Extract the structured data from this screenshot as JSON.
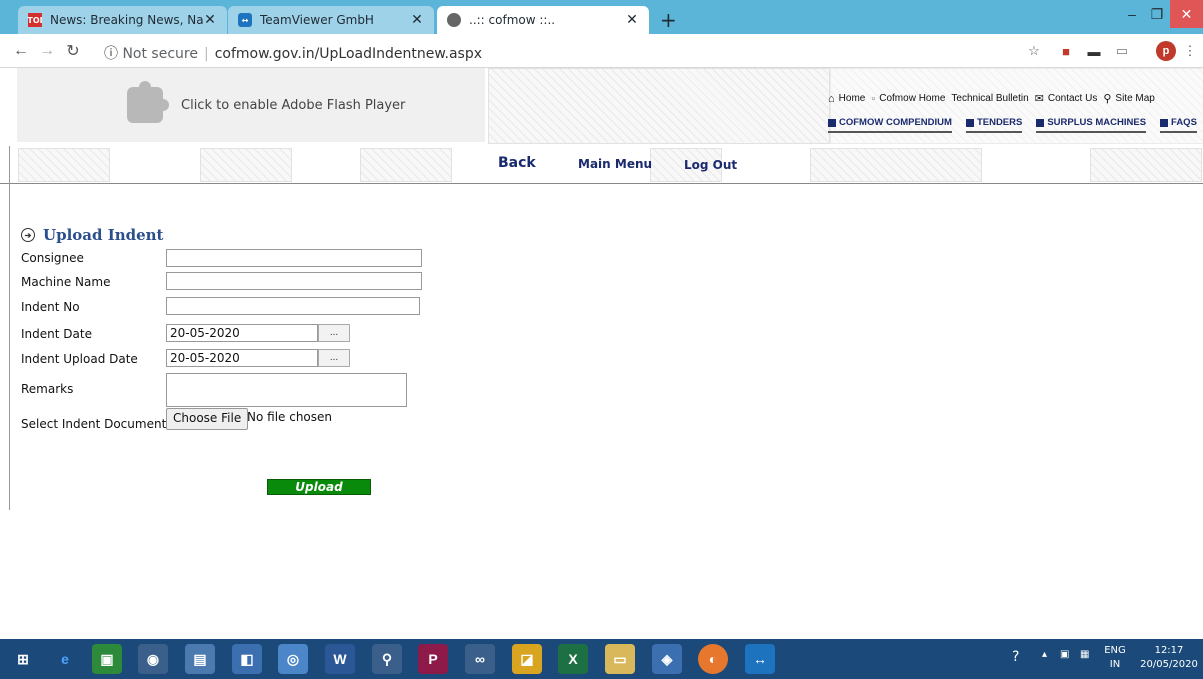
{
  "browser": {
    "tabs": [
      {
        "title": "News: Breaking News, National n",
        "favicon": "TOI",
        "active": false
      },
      {
        "title": "TeamViewer GmbH",
        "favicon": "teamviewer-icon",
        "active": false
      },
      {
        "title": "..:: cofmow ::..",
        "favicon": "globe-icon",
        "active": true
      }
    ],
    "new_tab_label": "+",
    "address": {
      "security": "Not secure",
      "url": "cofmow.gov.in/UpLoadIndentnew.aspx"
    },
    "profile_initial": "p"
  },
  "page": {
    "flash_prompt": "Click to enable Adobe Flash Player",
    "top_links": [
      "Home",
      "Cofmow Home",
      "Technical Bulletin",
      "Contact Us",
      "Site Map"
    ],
    "sub_links": [
      "COFMOW COMPENDIUM",
      "TENDERS",
      "SURPLUS MACHINES",
      "FAQS"
    ],
    "nav": {
      "back": "Back",
      "main_menu": "Main Menu",
      "logout": "Log Out"
    }
  },
  "form": {
    "title": "Upload Indent",
    "fields": {
      "consignee": {
        "label": "Consignee",
        "value": ""
      },
      "machine_name": {
        "label": "Machine Name",
        "value": ""
      },
      "indent_no": {
        "label": "Indent No",
        "value": ""
      },
      "indent_date": {
        "label": "Indent Date",
        "value": "20-05-2020"
      },
      "indent_upload_date": {
        "label": "Indent Upload Date",
        "value": "20-05-2020"
      },
      "remarks": {
        "label": "Remarks",
        "value": ""
      },
      "document": {
        "label": "Select Indent Document"
      }
    },
    "picker_label": "...",
    "choose_file": "Choose File",
    "no_file": "No file chosen",
    "upload": "Upload"
  },
  "taskbar": {
    "lang": "ENG",
    "region": "IN",
    "time": "12:17",
    "date": "20/05/2020"
  }
}
